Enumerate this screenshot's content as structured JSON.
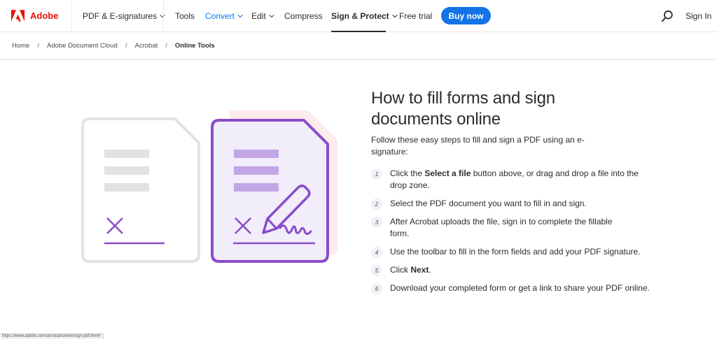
{
  "nav": {
    "brand": "Adobe",
    "items": [
      {
        "label": "PDF & E-signatures",
        "dropdown": true
      },
      {
        "label": "Tools",
        "dropdown": false
      },
      {
        "label": "Convert",
        "dropdown": true
      },
      {
        "label": "Edit",
        "dropdown": true
      },
      {
        "label": "Compress",
        "dropdown": false
      },
      {
        "label": "Sign & Protect",
        "dropdown": true
      },
      {
        "label": "Free trial",
        "dropdown": false
      }
    ],
    "buy_label": "Buy now",
    "signin_label": "Sign In",
    "accent_color": "#1473e6",
    "brand_color": "#eb1000"
  },
  "breadcrumb": {
    "items": [
      "Home",
      "Adobe Document Cloud",
      "Acrobat",
      "Online Tools"
    ],
    "separator": "/"
  },
  "main": {
    "heading_line1": "How to fill forms and sign",
    "heading_line2": "documents online",
    "intro": "Follow these easy steps to fill and sign a PDF using an e-signature:",
    "steps": [
      {
        "num": "1",
        "pre": "Click the ",
        "bold": "Select a file",
        "post": " button above, or drag and drop a file into the drop zone."
      },
      {
        "num": "2",
        "text": "Select the PDF document you want to fill in and sign."
      },
      {
        "num": "3",
        "text": "After Acrobat uploads the file, sign in to complete the fillable form."
      },
      {
        "num": "4",
        "text": "Use the toolbar to fill in the form fields and add your PDF signature."
      },
      {
        "num": "5",
        "pre": "Click ",
        "bold": "Next",
        "post": "."
      },
      {
        "num": "6",
        "text": "Download your completed form or get a link to share your PDF online."
      }
    ]
  },
  "status_url": "https://www.adobe.com/acrobat/online/sign-pdf.html#"
}
